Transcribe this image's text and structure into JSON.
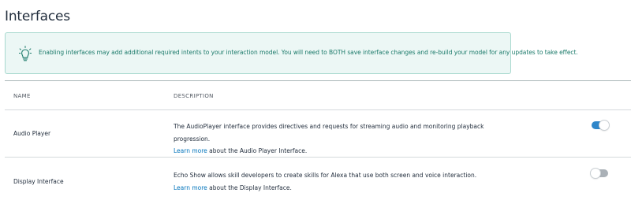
{
  "page": {
    "title": "Interfaces"
  },
  "banner": {
    "icon": "lightbulb-icon",
    "message": "Enabling interfaces may add additional required intents to your interaction model. You will need to BOTH save interface changes and re-build your model for any updates to take effect.",
    "color": "#1b7a6a",
    "background": "#ecf7f5"
  },
  "table": {
    "columns": [
      "NAME",
      "DESCRIPTION"
    ],
    "rows": [
      {
        "name": "Audio Player",
        "desc_text": "The AudioPlayer interface provides directives and requests for streaming audio and monitoring playback progression.",
        "link_text": "Learn more",
        "desc_suffix": " about the Audio Player Interface.",
        "enabled": true
      },
      {
        "name": "Display Interface",
        "desc_text": "Echo Show allows skill developers to create skills for Alexa that use both screen and voice interaction. ",
        "link_text": "Learn more",
        "desc_suffix": " about the Display Interface.",
        "enabled": false
      }
    ]
  },
  "colors": {
    "link": "#0073bb",
    "toggle_on": "#2e86c9",
    "toggle_off": "#aab1b7"
  }
}
